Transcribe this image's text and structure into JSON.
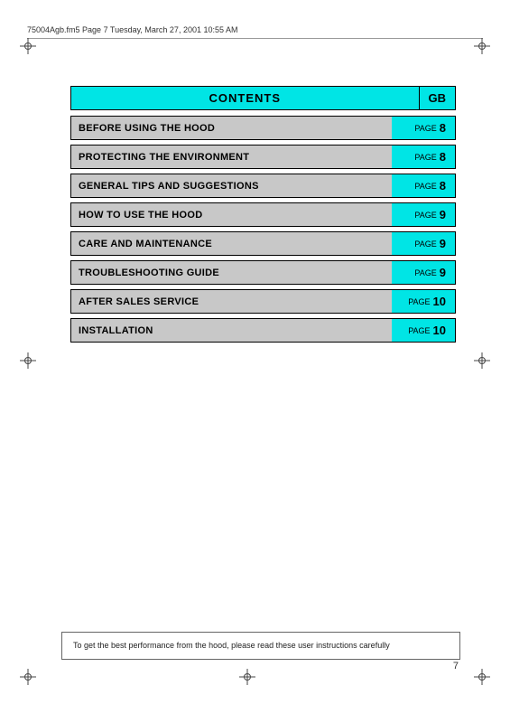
{
  "header": {
    "text": "75004Agb.fm5  Page 7  Tuesday, March 27, 2001  10:55 AM"
  },
  "title": {
    "label": "CONTENTS",
    "gb_label": "GB"
  },
  "toc_items": [
    {
      "label": "BEFORE USING THE HOOD",
      "page_word": "PAGE",
      "page_num": "8"
    },
    {
      "label": "PROTECTING THE ENVIRONMENT",
      "page_word": "PAGE",
      "page_num": "8"
    },
    {
      "label": "GENERAL TIPS AND SUGGESTIONS",
      "page_word": "PAGE",
      "page_num": "8"
    },
    {
      "label": "HOW TO USE THE HOOD",
      "page_word": "PAGE",
      "page_num": "9"
    },
    {
      "label": "CARE AND MAINTENANCE",
      "page_word": "PAGE",
      "page_num": "9"
    },
    {
      "label": "TROUBLESHOOTING GUIDE",
      "page_word": "PAGE",
      "page_num": "9"
    },
    {
      "label": "AFTER SALES SERVICE",
      "page_word": "PAGE",
      "page_num": "10"
    },
    {
      "label": "INSTALLATION",
      "page_word": "PAGE",
      "page_num": "10"
    }
  ],
  "bottom_note": "To get the best performance from the hood, please read these user instructions carefully",
  "page_number": "7"
}
